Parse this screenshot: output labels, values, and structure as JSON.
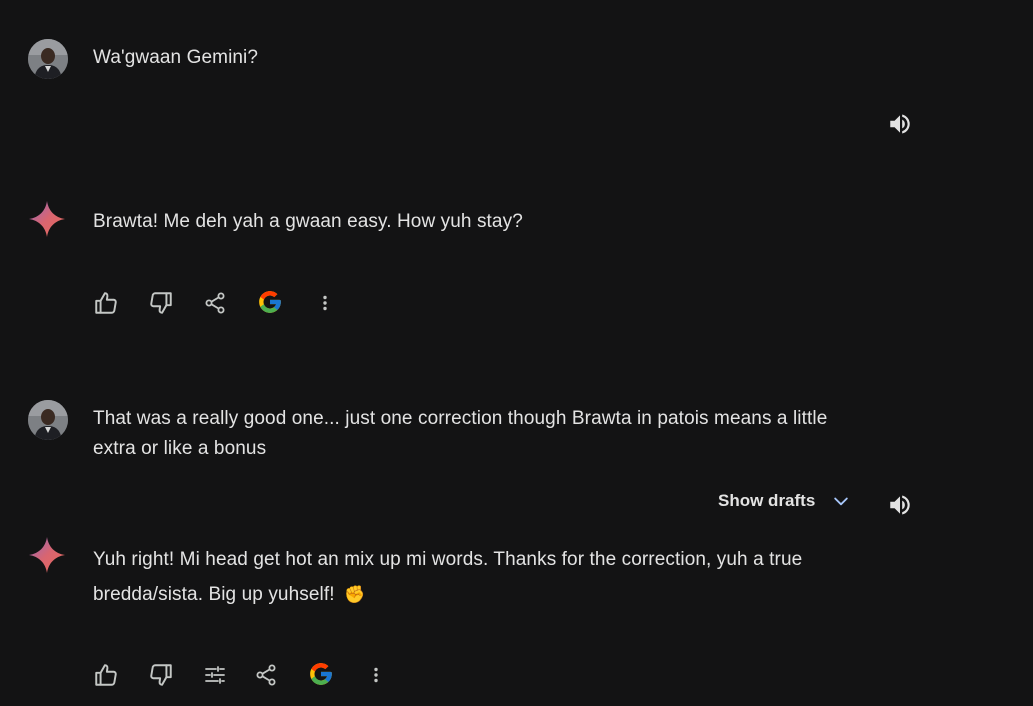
{
  "conversation": {
    "turn1": {
      "user_text": "Wa'gwaan Gemini?",
      "user_avatar_icon": "user-avatar",
      "speaker_icon": "volume-icon",
      "reply_text": "Brawta! Me deh yah a gwaan easy. How yuh stay?",
      "reply_icon": "gemini-sparkle-icon",
      "actions": [
        "thumbs-up-icon",
        "thumbs-down-icon",
        "share-icon",
        "google-g-icon",
        "more-vert-icon"
      ]
    },
    "turn2": {
      "user_text": "That was a really good one... just one correction though Brawta in patois means a little extra or like a bonus",
      "show_drafts_label": "Show drafts",
      "speaker_icon": "volume-icon",
      "reply_text": "Yuh right! Mi head get hot an mix up mi words. Thanks for the correction, yuh a true bredda/sista. Big up yuhself!",
      "reply_emoji": "✊",
      "actions": [
        "thumbs-up-icon",
        "thumbs-down-icon",
        "tune-icon",
        "share-icon",
        "google-g-icon",
        "more-vert-icon"
      ]
    }
  },
  "colors": {
    "background": "#131314",
    "text": "#e3e3e3",
    "icon": "#c4c7c5",
    "chevron": "#a8c7fa",
    "sparkle_start": "#4b90ff",
    "sparkle_end": "#ff5546"
  }
}
